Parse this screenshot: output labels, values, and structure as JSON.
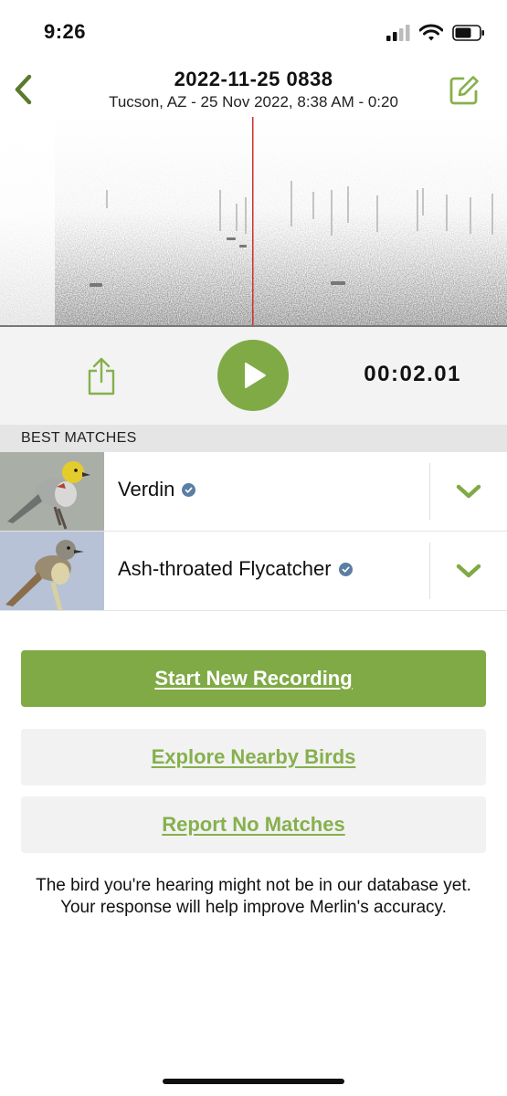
{
  "status_bar": {
    "time": "9:26",
    "icons": [
      "signal-icon",
      "wifi-icon",
      "battery-icon"
    ]
  },
  "header": {
    "title": "2022-11-25 0838",
    "subtitle": "Tucson, AZ - 25 Nov 2022, 8:38 AM - 0:20",
    "back_icon": "chevron-left-icon",
    "edit_icon": "edit-icon"
  },
  "player": {
    "timecode": "00:02.01",
    "share_icon": "share-icon",
    "play_icon": "play-icon"
  },
  "matches": {
    "section_title": "BEST MATCHES",
    "items": [
      {
        "name": "Verdin",
        "verified_icon": "verified-icon",
        "expand_icon": "chevron-down-icon"
      },
      {
        "name": "Ash-throated Flycatcher",
        "verified_icon": "verified-icon",
        "expand_icon": "chevron-down-icon"
      }
    ]
  },
  "actions": {
    "start_new_recording": "Start New Recording",
    "explore_nearby_birds": "Explore Nearby Birds",
    "report_no_matches": "Report No Matches"
  },
  "note": "The bird you're hearing might not be in our database yet. Your response will help improve Merlin's accuracy.",
  "colors": {
    "accent_green": "#7faa45",
    "link_green": "#86b04d",
    "playhead_red": "#d0312d",
    "verified_blue": "#5b7ea3"
  }
}
